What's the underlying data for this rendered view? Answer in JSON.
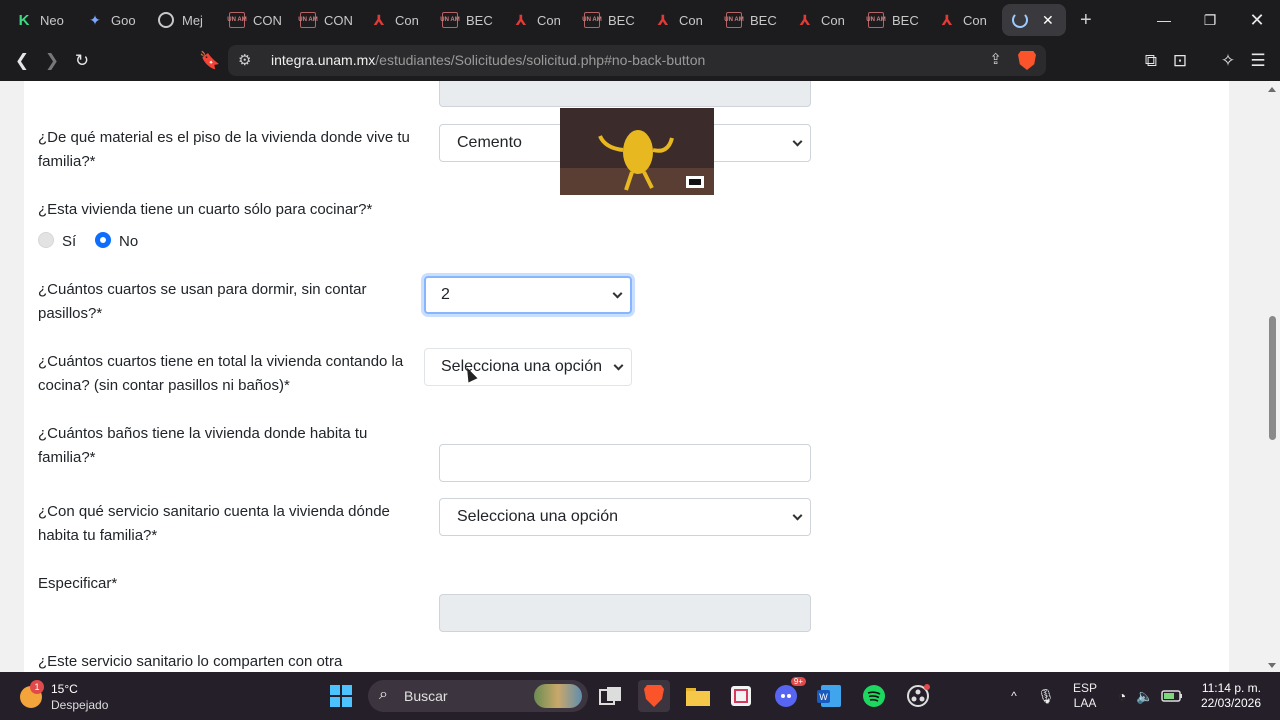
{
  "browser": {
    "tabs": [
      {
        "label": "Neo",
        "icon": "k-logo-icon"
      },
      {
        "label": "Goo",
        "icon": "gemini-star-icon"
      },
      {
        "label": "Mej",
        "icon": "record-icon"
      },
      {
        "label": "CON",
        "icon": "unam-icon"
      },
      {
        "label": "CON",
        "icon": "unam-icon"
      },
      {
        "label": "Con",
        "icon": "pdf-icon"
      },
      {
        "label": "BEC",
        "icon": "unam-icon"
      },
      {
        "label": "Con",
        "icon": "pdf-icon"
      },
      {
        "label": "BEC",
        "icon": "unam-icon"
      },
      {
        "label": "Con",
        "icon": "pdf-icon"
      },
      {
        "label": "BEC",
        "icon": "unam-icon"
      },
      {
        "label": "Con",
        "icon": "pdf-icon"
      },
      {
        "label": "BEC",
        "icon": "unam-icon"
      },
      {
        "label": "Con",
        "icon": "pdf-icon"
      }
    ],
    "url_host": "integra.unam.mx",
    "url_path": "/estudiantes/Solicitudes/solicitud.php#no-back-button"
  },
  "form": {
    "q_floor": "¿De qué material es el piso de la vivienda donde vive tu familia?*",
    "floor_value": "Cemento",
    "q_kitchen": "¿Esta vivienda tiene un cuarto sólo para cocinar?*",
    "kitchen_options": [
      "Sí",
      "No"
    ],
    "kitchen_selected": "No",
    "q_bedrooms": "¿Cuántos cuartos se usan para dormir, sin contar pasillos?*",
    "bedrooms_value": "2",
    "q_total_rooms": "¿Cuántos cuartos tiene en total la vivienda contando la cocina? (sin contar pasillos ni baños)*",
    "total_rooms_value": "Selecciona una opción",
    "q_bathrooms": "¿Cuántos baños tiene la vivienda donde habita tu familia?*",
    "bathrooms_value": "",
    "q_sanitary": "¿Con qué servicio sanitario cuenta la vivienda dónde habita tu familia?*",
    "sanitary_value": "Selecciona una opción",
    "q_specify": "Especificar*",
    "q_shared": "¿Este servicio sanitario lo comparten con otra"
  },
  "taskbar": {
    "weather_temp": "15°C",
    "weather_desc": "Despejado",
    "notification_count": "1",
    "search_label": "Buscar",
    "lang_top": "ESP",
    "lang_bottom": "LAA",
    "time": "11:14 p. m.",
    "date": "22/03/2026",
    "discord_badge": "9+"
  },
  "colors": {
    "accent": "#0d6efd",
    "focus_ring": "#86b7fe",
    "chrome_bg": "#1c1c1f",
    "taskbar_bg": "#251f2a"
  }
}
